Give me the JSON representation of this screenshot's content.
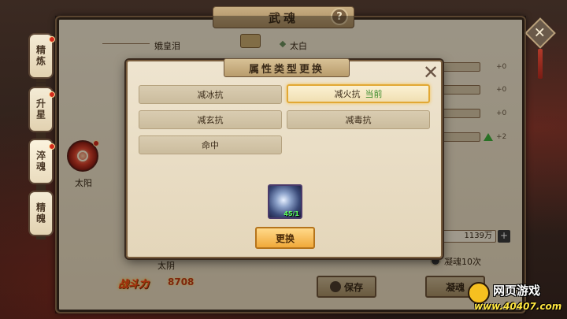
{
  "window": {
    "title": "武魂",
    "help_glyph": "?",
    "close_glyph": "✕"
  },
  "side_tabs": [
    {
      "label": "精炼"
    },
    {
      "label": "升星"
    },
    {
      "label": "淬魂"
    },
    {
      "label": "精魄"
    }
  ],
  "left": {
    "name_top": "娥皇泪",
    "node_label": "太阳",
    "name_bottom": "太阴",
    "power_label": "战斗力",
    "power_value": "8708"
  },
  "right": {
    "title": "太白",
    "stats": [
      "+0",
      "+0",
      "+0",
      "+2"
    ],
    "cost_value": "1139万",
    "plus_glyph": "+",
    "option_label": "凝魂10次",
    "save_label": "保存",
    "refine_label": "凝魂"
  },
  "modal": {
    "title": "属性类型更换",
    "close_glyph": "✕",
    "options": [
      {
        "label": "减冰抗",
        "current": ""
      },
      {
        "label": "减火抗",
        "current": "当前"
      },
      {
        "label": "减玄抗",
        "current": ""
      },
      {
        "label": "减毒抗",
        "current": ""
      },
      {
        "label": "命中",
        "current": ""
      }
    ],
    "item_count": "45/1",
    "change_label": "更换"
  },
  "watermark": {
    "text1": "网页游戏",
    "text2": "www.40407.com"
  }
}
